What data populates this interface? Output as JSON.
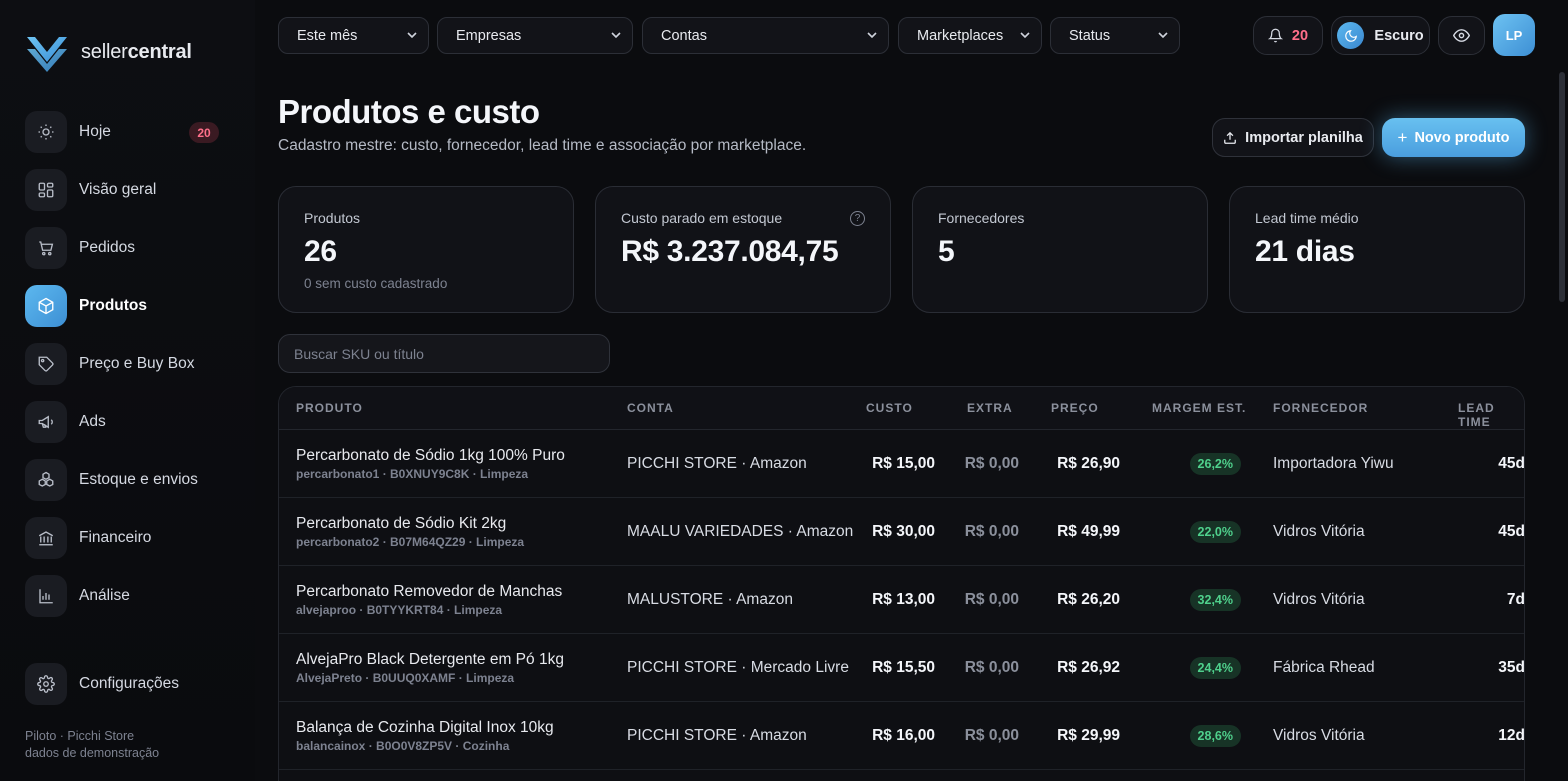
{
  "brand": {
    "light": "seller",
    "bold": "central"
  },
  "sidebar": {
    "items": [
      {
        "label": "Hoje",
        "icon": "sun-icon",
        "badge": "20",
        "active": false
      },
      {
        "label": "Visão geral",
        "icon": "grid-icon",
        "active": false
      },
      {
        "label": "Pedidos",
        "icon": "cart-icon",
        "active": false
      },
      {
        "label": "Produtos",
        "icon": "box-icon",
        "active": true
      },
      {
        "label": "Preço e Buy Box",
        "icon": "tag-icon",
        "active": false
      },
      {
        "label": "Ads",
        "icon": "megaphone-icon",
        "active": false
      },
      {
        "label": "Estoque e envios",
        "icon": "boxes-icon",
        "active": false
      },
      {
        "label": "Financeiro",
        "icon": "bank-icon",
        "active": false
      },
      {
        "label": "Análise",
        "icon": "bar-chart-icon",
        "active": false
      }
    ],
    "settings_label": "Configurações",
    "footer_line1": "Piloto · Picchi Store",
    "footer_line2": "dados de demonstração"
  },
  "filters": [
    "Este mês",
    "Empresas",
    "Contas",
    "Marketplaces",
    "Status"
  ],
  "topbar": {
    "notifications_count": "20",
    "theme_label": "Escuro",
    "avatar_initials": "LP"
  },
  "page": {
    "title": "Produtos e custo",
    "subtitle": "Cadastro mestre: custo, fornecedor, lead time e associação por marketplace.",
    "import_label": "Importar planilha",
    "new_label": "Novo produto"
  },
  "kpis": [
    {
      "label": "Produtos",
      "value": "26",
      "hint": "0 sem custo cadastrado"
    },
    {
      "label": "Custo parado em estoque",
      "value": "R$ 3.237.084,75",
      "help": "?"
    },
    {
      "label": "Fornecedores",
      "value": "5"
    },
    {
      "label": "Lead time médio",
      "value": "21 dias"
    }
  ],
  "search": {
    "placeholder": "Buscar SKU ou título"
  },
  "table": {
    "headers": [
      "PRODUTO",
      "CONTA",
      "CUSTO",
      "EXTRA",
      "PREÇO",
      "MARGEM EST.",
      "FORNECEDOR",
      "LEAD TIME"
    ],
    "rows": [
      {
        "title": "Percarbonato de Sódio 1kg 100% Puro",
        "meta": "percarbonato1 · B0XNUY9C8K · Limpeza",
        "account": "PICCHI STORE · Amazon",
        "cost": "R$ 15,00",
        "extra": "R$ 0,00",
        "price": "R$ 26,90",
        "margin": "26,2%",
        "supplier": "Importadora Yiwu",
        "lead": "45d"
      },
      {
        "title": "Percarbonato de Sódio Kit 2kg",
        "meta": "percarbonato2 · B07M64QZ29 · Limpeza",
        "account": "MAALU VARIEDADES · Amazon",
        "cost": "R$ 30,00",
        "extra": "R$ 0,00",
        "price": "R$ 49,99",
        "margin": "22,0%",
        "supplier": "Vidros Vitória",
        "lead": "45d"
      },
      {
        "title": "Percarbonato Removedor de Manchas",
        "meta": "alvejaproo · B0TYYKRT84 · Limpeza",
        "account": "MALUSTORE · Amazon",
        "cost": "R$ 13,00",
        "extra": "R$ 0,00",
        "price": "R$ 26,20",
        "margin": "32,4%",
        "supplier": "Vidros Vitória",
        "lead": "7d"
      },
      {
        "title": "AlvejaPro Black Detergente em Pó 1kg",
        "meta": "AlvejaPreto · B0UUQ0XAMF · Limpeza",
        "account": "PICCHI STORE · Mercado Livre",
        "cost": "R$ 15,50",
        "extra": "R$ 0,00",
        "price": "R$ 26,92",
        "margin": "24,4%",
        "supplier": "Fábrica Rhead",
        "lead": "35d"
      },
      {
        "title": "Balança de Cozinha Digital Inox 10kg",
        "meta": "balancainox · B0O0V8ZP5V · Cozinha",
        "account": "PICCHI STORE · Amazon",
        "cost": "R$ 16,00",
        "extra": "R$ 0,00",
        "price": "R$ 29,99",
        "margin": "28,6%",
        "supplier": "Vidros Vitória",
        "lead": "12d"
      }
    ]
  },
  "colors": {
    "accent": "#5cb8ef",
    "danger": "#ff6f8a",
    "success": "#4fd08c",
    "background": "#0b0c0f"
  }
}
